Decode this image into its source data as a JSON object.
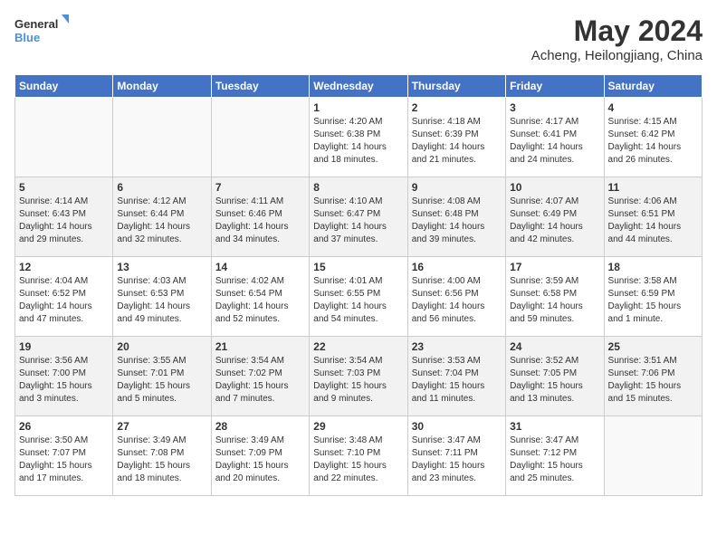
{
  "header": {
    "logo_line1": "General",
    "logo_line2": "Blue",
    "month_title": "May 2024",
    "location": "Acheng, Heilongjiang, China"
  },
  "days_of_week": [
    "Sunday",
    "Monday",
    "Tuesday",
    "Wednesday",
    "Thursday",
    "Friday",
    "Saturday"
  ],
  "weeks": [
    [
      {
        "day": "",
        "info": ""
      },
      {
        "day": "",
        "info": ""
      },
      {
        "day": "",
        "info": ""
      },
      {
        "day": "1",
        "info": "Sunrise: 4:20 AM\nSunset: 6:38 PM\nDaylight: 14 hours\nand 18 minutes."
      },
      {
        "day": "2",
        "info": "Sunrise: 4:18 AM\nSunset: 6:39 PM\nDaylight: 14 hours\nand 21 minutes."
      },
      {
        "day": "3",
        "info": "Sunrise: 4:17 AM\nSunset: 6:41 PM\nDaylight: 14 hours\nand 24 minutes."
      },
      {
        "day": "4",
        "info": "Sunrise: 4:15 AM\nSunset: 6:42 PM\nDaylight: 14 hours\nand 26 minutes."
      }
    ],
    [
      {
        "day": "5",
        "info": "Sunrise: 4:14 AM\nSunset: 6:43 PM\nDaylight: 14 hours\nand 29 minutes."
      },
      {
        "day": "6",
        "info": "Sunrise: 4:12 AM\nSunset: 6:44 PM\nDaylight: 14 hours\nand 32 minutes."
      },
      {
        "day": "7",
        "info": "Sunrise: 4:11 AM\nSunset: 6:46 PM\nDaylight: 14 hours\nand 34 minutes."
      },
      {
        "day": "8",
        "info": "Sunrise: 4:10 AM\nSunset: 6:47 PM\nDaylight: 14 hours\nand 37 minutes."
      },
      {
        "day": "9",
        "info": "Sunrise: 4:08 AM\nSunset: 6:48 PM\nDaylight: 14 hours\nand 39 minutes."
      },
      {
        "day": "10",
        "info": "Sunrise: 4:07 AM\nSunset: 6:49 PM\nDaylight: 14 hours\nand 42 minutes."
      },
      {
        "day": "11",
        "info": "Sunrise: 4:06 AM\nSunset: 6:51 PM\nDaylight: 14 hours\nand 44 minutes."
      }
    ],
    [
      {
        "day": "12",
        "info": "Sunrise: 4:04 AM\nSunset: 6:52 PM\nDaylight: 14 hours\nand 47 minutes."
      },
      {
        "day": "13",
        "info": "Sunrise: 4:03 AM\nSunset: 6:53 PM\nDaylight: 14 hours\nand 49 minutes."
      },
      {
        "day": "14",
        "info": "Sunrise: 4:02 AM\nSunset: 6:54 PM\nDaylight: 14 hours\nand 52 minutes."
      },
      {
        "day": "15",
        "info": "Sunrise: 4:01 AM\nSunset: 6:55 PM\nDaylight: 14 hours\nand 54 minutes."
      },
      {
        "day": "16",
        "info": "Sunrise: 4:00 AM\nSunset: 6:56 PM\nDaylight: 14 hours\nand 56 minutes."
      },
      {
        "day": "17",
        "info": "Sunrise: 3:59 AM\nSunset: 6:58 PM\nDaylight: 14 hours\nand 59 minutes."
      },
      {
        "day": "18",
        "info": "Sunrise: 3:58 AM\nSunset: 6:59 PM\nDaylight: 15 hours\nand 1 minute."
      }
    ],
    [
      {
        "day": "19",
        "info": "Sunrise: 3:56 AM\nSunset: 7:00 PM\nDaylight: 15 hours\nand 3 minutes."
      },
      {
        "day": "20",
        "info": "Sunrise: 3:55 AM\nSunset: 7:01 PM\nDaylight: 15 hours\nand 5 minutes."
      },
      {
        "day": "21",
        "info": "Sunrise: 3:54 AM\nSunset: 7:02 PM\nDaylight: 15 hours\nand 7 minutes."
      },
      {
        "day": "22",
        "info": "Sunrise: 3:54 AM\nSunset: 7:03 PM\nDaylight: 15 hours\nand 9 minutes."
      },
      {
        "day": "23",
        "info": "Sunrise: 3:53 AM\nSunset: 7:04 PM\nDaylight: 15 hours\nand 11 minutes."
      },
      {
        "day": "24",
        "info": "Sunrise: 3:52 AM\nSunset: 7:05 PM\nDaylight: 15 hours\nand 13 minutes."
      },
      {
        "day": "25",
        "info": "Sunrise: 3:51 AM\nSunset: 7:06 PM\nDaylight: 15 hours\nand 15 minutes."
      }
    ],
    [
      {
        "day": "26",
        "info": "Sunrise: 3:50 AM\nSunset: 7:07 PM\nDaylight: 15 hours\nand 17 minutes."
      },
      {
        "day": "27",
        "info": "Sunrise: 3:49 AM\nSunset: 7:08 PM\nDaylight: 15 hours\nand 18 minutes."
      },
      {
        "day": "28",
        "info": "Sunrise: 3:49 AM\nSunset: 7:09 PM\nDaylight: 15 hours\nand 20 minutes."
      },
      {
        "day": "29",
        "info": "Sunrise: 3:48 AM\nSunset: 7:10 PM\nDaylight: 15 hours\nand 22 minutes."
      },
      {
        "day": "30",
        "info": "Sunrise: 3:47 AM\nSunset: 7:11 PM\nDaylight: 15 hours\nand 23 minutes."
      },
      {
        "day": "31",
        "info": "Sunrise: 3:47 AM\nSunset: 7:12 PM\nDaylight: 15 hours\nand 25 minutes."
      },
      {
        "day": "",
        "info": ""
      }
    ]
  ]
}
